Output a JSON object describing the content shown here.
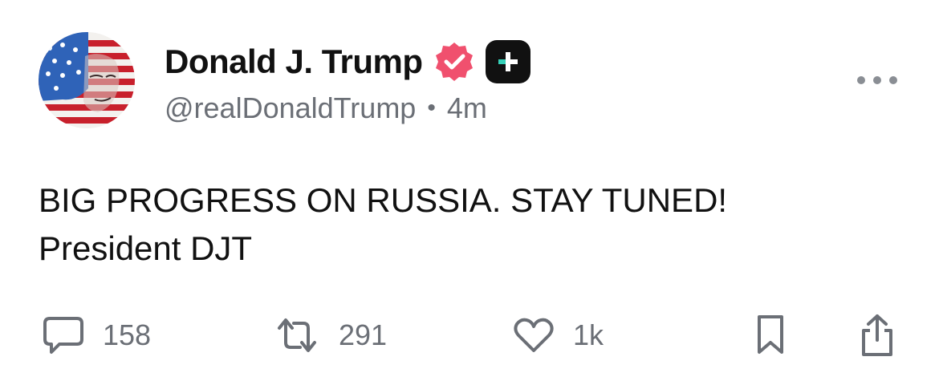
{
  "post": {
    "author": {
      "display_name": "Donald J. Trump",
      "handle": "@realDonaldTrump",
      "separator": "•",
      "time_ago": "4m",
      "verified_badge_color": "#f0506e",
      "avatar_icon": "flag-portrait-avatar"
    },
    "text_lines": [
      "BIG PROGRESS ON RUSSIA. STAY TUNED!",
      "President DJT"
    ],
    "actions": {
      "replies": "158",
      "reposts": "291",
      "likes": "1k"
    }
  },
  "colors": {
    "text": "#111111",
    "muted": "#6b6f76",
    "badge_dark": "#111111",
    "badge_accent": "#35d0b8"
  }
}
